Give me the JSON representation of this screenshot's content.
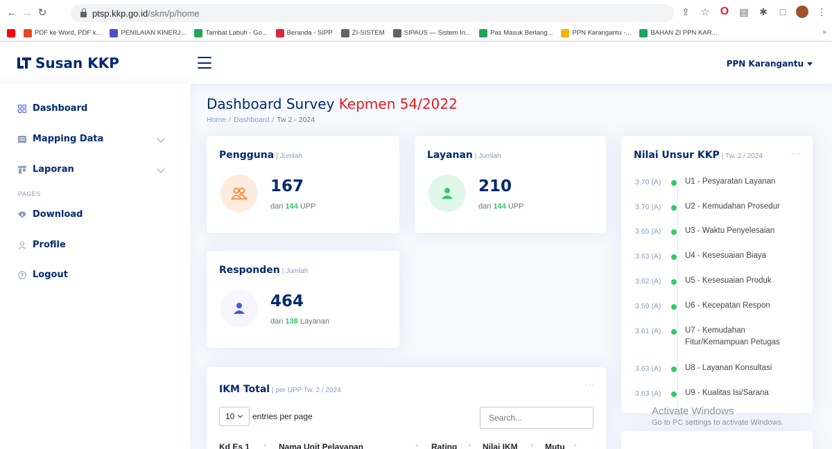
{
  "browser": {
    "url_host": "ptsp.kkp.go.id",
    "url_path": "/skm/p/home",
    "bookmarks": [
      {
        "label": "",
        "color": "#ff0000"
      },
      {
        "label": "PDF ke Word, PDF k...",
        "color": "#e8451f"
      },
      {
        "label": "PENILAIAN KINERJ...",
        "color": "#4a52c8"
      },
      {
        "label": "Tambat Labuh - Go...",
        "color": "#23a55a"
      },
      {
        "label": "Beranda - SIPP",
        "color": "#d9263c"
      },
      {
        "label": "ZI-SISTEM",
        "color": "#5f6368"
      },
      {
        "label": "SIPAUS — Sistem In...",
        "color": "#5f6368"
      },
      {
        "label": "Pas Masuk Berlang...",
        "color": "#23a55a"
      },
      {
        "label": "PPN Karangantu -...",
        "color": "#f4b400"
      },
      {
        "label": "BAHAN ZI PPN KAR...",
        "color": "#1fa463"
      }
    ]
  },
  "header": {
    "logo_text": "Susan KKP",
    "profile_name": "PPN Karangantu"
  },
  "sidebar": {
    "items": [
      {
        "label": "Dashboard",
        "icon": "grid-icon"
      },
      {
        "label": "Mapping Data",
        "icon": "menu-icon"
      },
      {
        "label": "Laporan",
        "icon": "layout-icon"
      }
    ],
    "section_heading": "PAGES",
    "pages": [
      {
        "label": "Download",
        "icon": "cloud-download-icon"
      },
      {
        "label": "Profile",
        "icon": "person-icon"
      },
      {
        "label": "Logout",
        "icon": "question-circle-icon"
      }
    ]
  },
  "page": {
    "title": "Dashboard Survey ",
    "title_accent": "Kepmen 54/2022",
    "breadcrumb": [
      "Home",
      "Dashboard",
      "Tw 2 - 2024"
    ]
  },
  "cards": {
    "pengguna": {
      "title": "Pengguna",
      "subtitle": "| Jumlah",
      "value": "167",
      "sub_prefix": "dari",
      "sub_count": "144",
      "sub_suffix": "UPP",
      "icon_color": "#ff771d",
      "icon_bg": "#ffecdf"
    },
    "layanan": {
      "title": "Layanan",
      "subtitle": "| Jumlah",
      "value": "210",
      "sub_prefix": "dari",
      "sub_count": "144",
      "sub_suffix": "UPP",
      "icon_color": "#2eca6a",
      "icon_bg": "#e0f8e9"
    },
    "responden": {
      "title": "Responden",
      "subtitle": "| Jumlah",
      "value": "464",
      "sub_prefix": "dari",
      "sub_count": "138",
      "sub_suffix": "Layanan",
      "icon_color": "#4154f1",
      "icon_bg": "#f6f6fe"
    }
  },
  "ikm": {
    "title": "IKM Total",
    "subtitle": "| per UPP Tw. 2 / 2024",
    "entries_value": "10",
    "entries_label": "entries per page",
    "search_placeholder": "Search...",
    "columns": [
      "Kd Es 1",
      "Nama Unit Pelayanan",
      "Rating",
      "Nilai IKM",
      "Mutu"
    ]
  },
  "unsur": {
    "title": "Nilai Unsur KKP",
    "subtitle": "| Tw. 2 / 2024",
    "items": [
      {
        "value": "3.70 (A)",
        "label": "U1 - Pesyaratan Layanan"
      },
      {
        "value": "3.70 (A)",
        "label": "U2 - Kemudahan Prosedur"
      },
      {
        "value": "3.65 (A)",
        "label": "U3 - Waktu Penyelesaian"
      },
      {
        "value": "3.63 (A)",
        "label": "U4 - Kesesuaian Biaya"
      },
      {
        "value": "3.62 (A)",
        "label": "U5 - Kesesuaian Produk"
      },
      {
        "value": "3.59 (A)",
        "label": "U6 - Kecepatan Respon"
      },
      {
        "value": "3.61 (A)",
        "label": "U7 - Kemudahan Fitur/Kemampuan Petugas"
      },
      {
        "value": "3.63 (A)",
        "label": "U8 - Layanan Konsultasi"
      },
      {
        "value": "3.63 (A)",
        "label": "U9 - Kualitas Isi/Sarana"
      }
    ]
  },
  "watermark": {
    "line1": "Activate Windows",
    "line2": "Go to PC settings to activate Windows."
  }
}
